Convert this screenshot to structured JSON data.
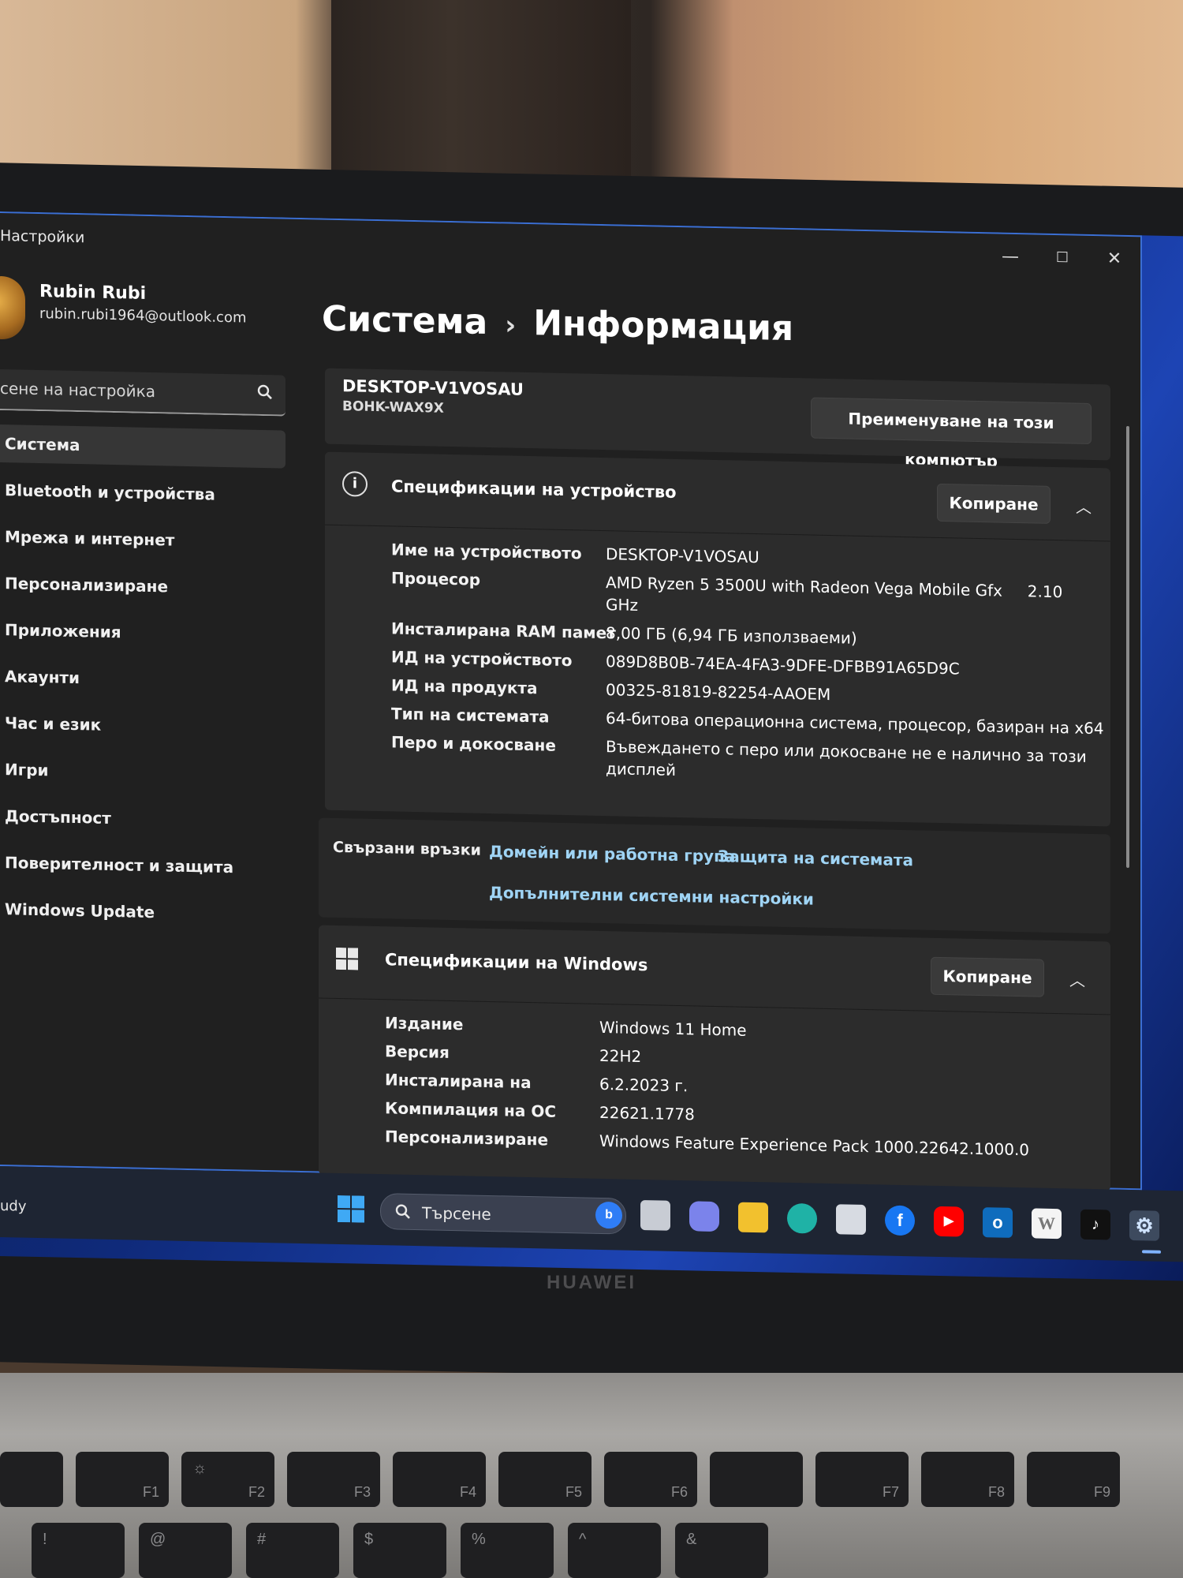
{
  "window": {
    "app_title": "Настройки",
    "controls": {
      "minimize": "—",
      "maximize": "☐",
      "close": "✕"
    }
  },
  "profile": {
    "name": "Rubin Rubi",
    "email": "rubin.rubi1964@outlook.com"
  },
  "search": {
    "placeholder": "сене на настройка"
  },
  "nav": {
    "items": [
      {
        "label": "Система",
        "active": true
      },
      {
        "label": "Bluetooth и устройства"
      },
      {
        "label": "Мрежа и интернет"
      },
      {
        "label": "Персонализиране"
      },
      {
        "label": "Приложения"
      },
      {
        "label": "Акаунти"
      },
      {
        "label": "Час и език"
      },
      {
        "label": "Игри"
      },
      {
        "label": "Достъпност"
      },
      {
        "label": "Поверителност и защита"
      },
      {
        "label": "Windows Update"
      }
    ]
  },
  "breadcrumb": {
    "parent": "Система",
    "separator": "›",
    "current": "Информация"
  },
  "device_card": {
    "pc_name": "DESKTOP-V1VOSAU",
    "model": "BOHK-WAX9X",
    "rename_button": "Преименуване на този компютър"
  },
  "device_specs": {
    "title": "Спецификации на устройство",
    "copy_button": "Копиране",
    "rows": [
      {
        "label": "Име на устройството",
        "value": "DESKTOP-V1VOSAU"
      },
      {
        "label": "Процесор",
        "value": "AMD Ryzen 5 3500U with Radeon Vega Mobile Gfx     2.10",
        "value2": "GHz"
      },
      {
        "label": "Инсталирана RAM памет",
        "value": "8,00 ГБ (6,94 ГБ използваеми)"
      },
      {
        "label": "ИД на устройството",
        "value": "089D8B0B-74EA-4FA3-9DFE-DFBB91A65D9C"
      },
      {
        "label": "ИД на продукта",
        "value": "00325-81819-82254-AAOEM"
      },
      {
        "label": "Тип на системата",
        "value": "64-битова операционна система, процесор, базиран на x64"
      },
      {
        "label": "Перо и докосване",
        "value": "Въвеждането с перо или докосване не е налично за този",
        "value2": "дисплей"
      }
    ]
  },
  "related_links": {
    "label": "Свързани връзки",
    "links": [
      "Домейн или работна група",
      "Защита на системата",
      "Допълнителни системни настройки"
    ]
  },
  "windows_specs": {
    "title": "Спецификации на Windows",
    "copy_button": "Копиране",
    "rows": [
      {
        "label": "Издание",
        "value": "Windows 11 Home"
      },
      {
        "label": "Версия",
        "value": "22H2"
      },
      {
        "label": "Инсталирана на",
        "value": "6.2.2023 г."
      },
      {
        "label": "Компилация на ОС",
        "value": "22621.1778"
      },
      {
        "label": "Персонализиране",
        "value": "Windows Feature Experience Pack 1000.22642.1000.0"
      }
    ]
  },
  "taskbar": {
    "left_text": "udy",
    "search_text": "Търсене",
    "apps": [
      "bing-icon",
      "task-view-icon",
      "teams-chat-icon",
      "file-explorer-icon",
      "edge-icon",
      "store-icon",
      "facebook-icon",
      "youtube-icon",
      "outlook-icon",
      "wikipedia-icon",
      "tiktok-icon",
      "settings-icon"
    ],
    "wiki_glyph": "W"
  },
  "laptop": {
    "brand": "HUAWEI"
  },
  "keyboard": {
    "keys": [
      "F1",
      "F2",
      "F3",
      "F4",
      "F5",
      "F6",
      "F7",
      "F8",
      "F9"
    ],
    "bottom_row": [
      "!",
      "@",
      "#",
      "$",
      "%",
      "^",
      "&"
    ]
  },
  "colors": {
    "accent": "#3b6fd3",
    "link": "#9fd4f5",
    "window_bg": "#202020",
    "card_bg": "#2c2c2c"
  }
}
